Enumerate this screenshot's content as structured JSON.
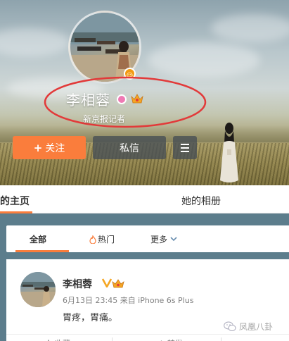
{
  "profile": {
    "name": "李相蓉",
    "subtitle": "新京报记者",
    "follow_label": "关注",
    "follow_plus": "+",
    "message_label": "私信",
    "menu_icon": "hamburger-icon"
  },
  "tabs": [
    {
      "label": "的主页"
    },
    {
      "label": "她的相册"
    }
  ],
  "filters": [
    {
      "label": "全部"
    },
    {
      "label": "热门"
    },
    {
      "label": "更多"
    }
  ],
  "post": {
    "author": "李相蓉",
    "time": "6月13日 23:45 来自 iPhone 6s Plus",
    "text": "胃疼，胃痛。",
    "actions": [
      {
        "label": "收藏"
      },
      {
        "label": "转发"
      }
    ]
  },
  "watermark": {
    "text": "凤凰八卦"
  },
  "colors": {
    "accent_orange": "#fa7d3c",
    "annotation_red": "#e23a3a",
    "verified_gold": "#f5a623"
  }
}
